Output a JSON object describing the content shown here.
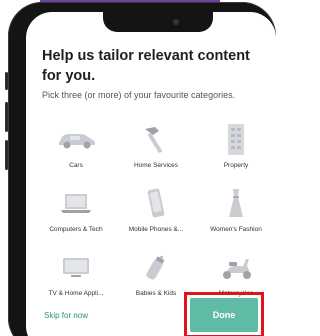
{
  "prompt": {
    "title": "Help us tailor relevant content for you.",
    "subtitle": "Pick three (or more) of your favourite categories."
  },
  "categories": [
    {
      "label": "Cars",
      "icon": "car-icon"
    },
    {
      "label": "Home Services",
      "icon": "hammer-icon"
    },
    {
      "label": "Property",
      "icon": "building-icon"
    },
    {
      "label": "Computers & Tech",
      "icon": "laptop-icon"
    },
    {
      "label": "Mobile Phones &...",
      "icon": "phone-icon"
    },
    {
      "label": "Women's Fashion",
      "icon": "dress-icon"
    },
    {
      "label": "TV & Home Appli...",
      "icon": "tv-icon"
    },
    {
      "label": "Babies & Kids",
      "icon": "baby-bottle-icon"
    },
    {
      "label": "Motorcycles",
      "icon": "scooter-icon"
    }
  ],
  "footer": {
    "skip_label": "Skip for now",
    "done_label": "Done"
  },
  "colors": {
    "accent_teal": "#5fbaa6",
    "link_teal": "#2f8f7d",
    "highlight_red": "#e0151b",
    "icon_gray": "#c9ccd1",
    "banner_purple": "#6e3fa3"
  }
}
